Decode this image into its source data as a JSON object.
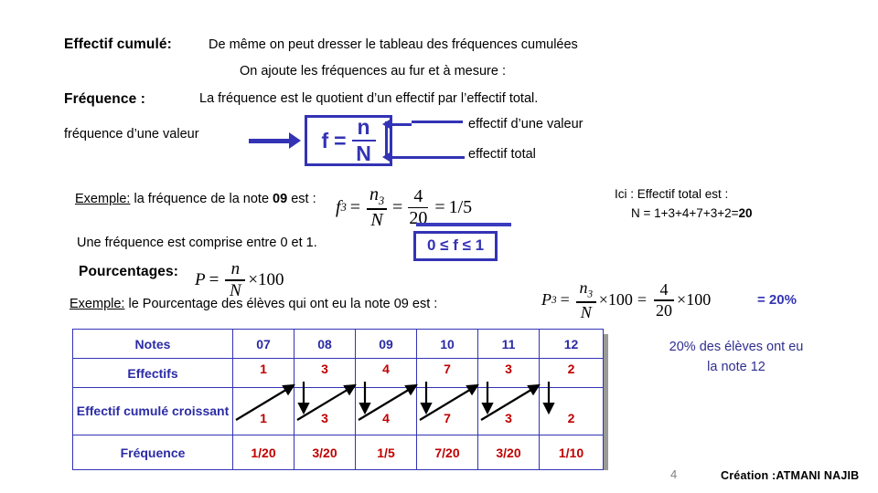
{
  "slide": {
    "lines": {
      "effectif_cumule_label": "Effectif cumulé:",
      "effectif_cumule_text": "De même on peut dresser le tableau des fréquences cumulées",
      "ajoute_text": "On ajoute les fréquences au fur et à mesure :",
      "frequence_label": "Fréquence  :",
      "frequence_text": "La fréquence est le quotient d’un effectif par l’effectif total."
    },
    "formula_box": {
      "f": "f",
      "equals": "=",
      "numerator": "n",
      "denominator": "N",
      "left_label": "fréquence d’une valeur",
      "right_label_top": "effectif d’une valeur",
      "right_label_bottom": "effectif total"
    },
    "example_frequency": {
      "prefix_underlined": "Exemple:",
      "text": "la fréquence de la note",
      "note": "09",
      "est": "est  :",
      "formula": {
        "lhs": "f",
        "lhs_sub": "3",
        "eq1": "=",
        "frac1_num": "n",
        "frac1_num_sub": "3",
        "frac1_den": "N",
        "eq2": "=",
        "frac2_num": "4",
        "frac2_den": "20",
        "eq3": "=",
        "result": "1/5"
      }
    },
    "total_note": {
      "line1": "Ici : Effectif total  est :",
      "line2_prefix": "N = 1+3+4+7+3+2=",
      "line2_total": "20"
    },
    "range_line": {
      "text": "Une fréquence est comprise entre 0 et 1.",
      "box": "0 ≤ f ≤ 1"
    },
    "percent_section": {
      "label": "Pourcentages:",
      "formula": {
        "lhs": "P",
        "eq": "=",
        "num": "n",
        "den": "N",
        "times": "×100"
      }
    },
    "example_percent": {
      "prefix_underlined": "Exemple:",
      "text_a": "le Pourcentage",
      "text_b": "des élèves  qui ont eu la note",
      "note": "09",
      "est": "est :",
      "formula": {
        "lhs": "P",
        "lhs_sub": "3",
        "eq1": "=",
        "frac1_num": "n",
        "frac1_num_sub": "3",
        "frac1_den": "N",
        "times1": "×100",
        "eq2": "=",
        "frac2_num": "4",
        "frac2_den": "20",
        "times2": "×100"
      },
      "result": "= 20%"
    },
    "table": {
      "rows": [
        {
          "header": "Notes",
          "type": "header",
          "cells": [
            "07",
            "08",
            "09",
            "10",
            "11",
            "12"
          ]
        },
        {
          "header": "Effectifs",
          "type": "value",
          "cells": [
            "1",
            "3",
            "4",
            "7",
            "3",
            "2"
          ]
        },
        {
          "header": "Effectif cumulé croissant",
          "type": "value",
          "cells": [
            "1",
            "3",
            "4",
            "7",
            "3",
            "2"
          ]
        },
        {
          "header": "Fréquence",
          "type": "value",
          "cells": [
            "1/20",
            "3/20",
            "1/5",
            "7/20",
            "3/20",
            "1/10"
          ]
        }
      ]
    },
    "side_note": {
      "line1": "20% des élèves ont eu",
      "line2": "la note 12"
    },
    "footer": {
      "page_number": "4",
      "credit": "Création :ATMANI NAJIB"
    },
    "colors": {
      "blue": "#3333B5",
      "navy": "#2f2f8f",
      "red": "#C00000",
      "gray": "#808080"
    }
  }
}
